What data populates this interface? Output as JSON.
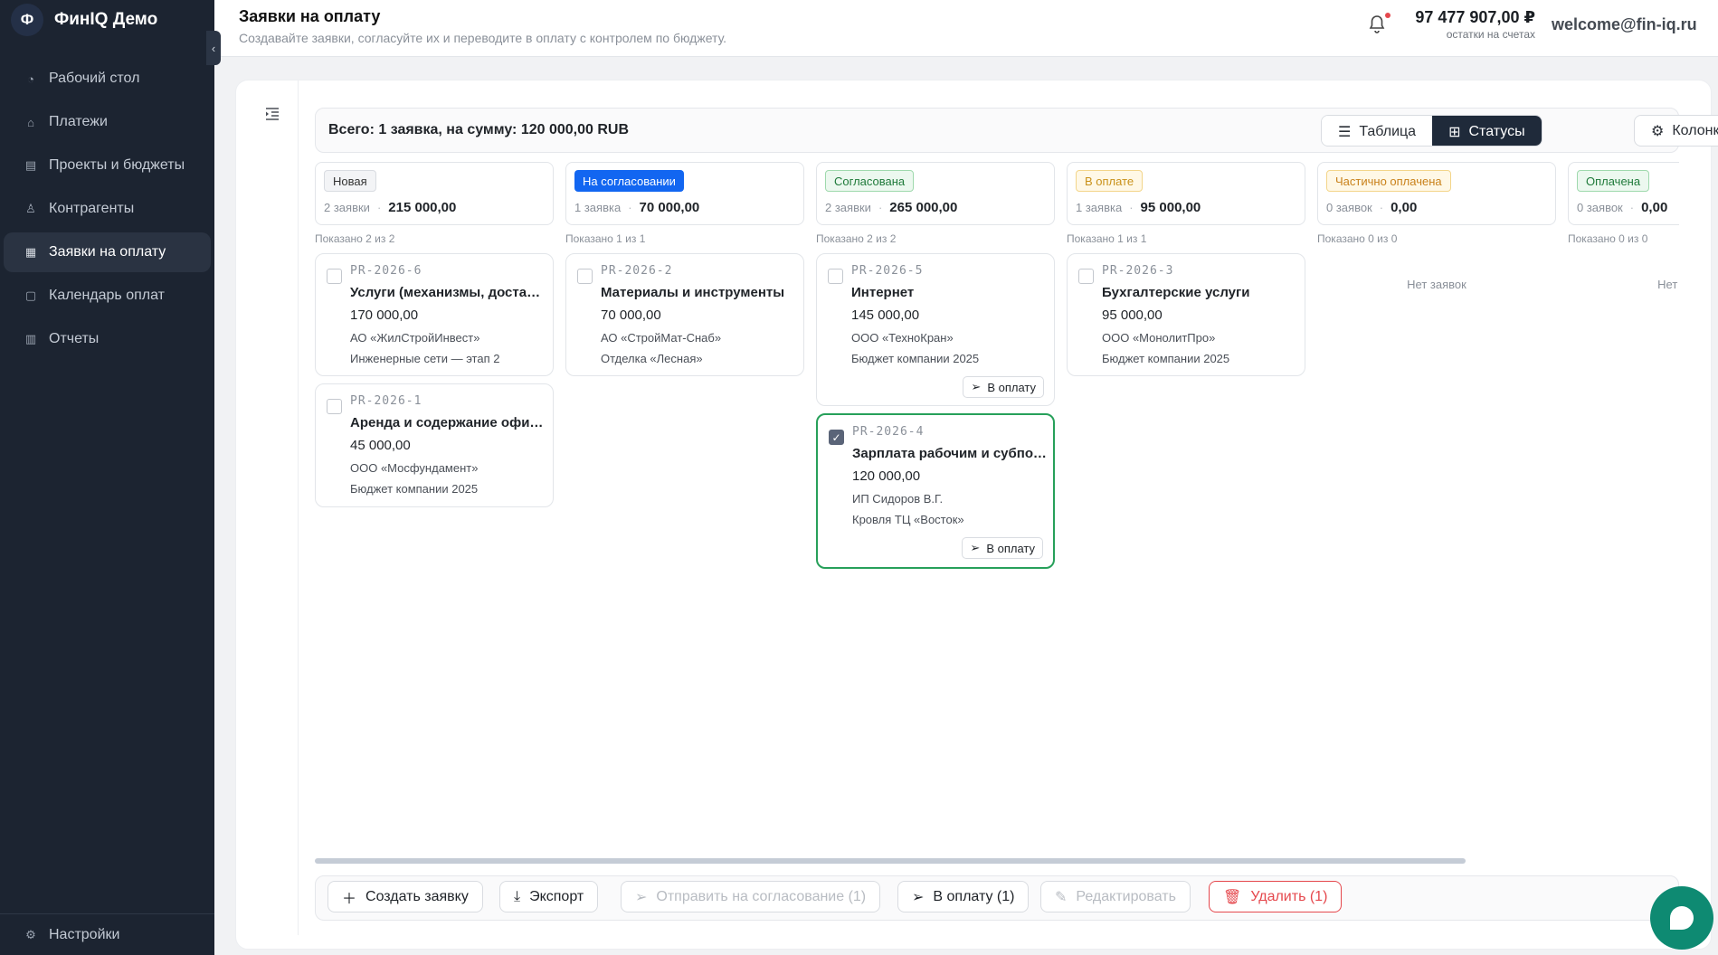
{
  "app": {
    "logo_letter": "Ф",
    "name": "ФинIQ Демо"
  },
  "sidebar": {
    "items": [
      {
        "label": "Рабочий стол",
        "icon": "dashboard-icon"
      },
      {
        "label": "Платежи",
        "icon": "bank-icon"
      },
      {
        "label": "Проекты и бюджеты",
        "icon": "projects-icon"
      },
      {
        "label": "Контрагенты",
        "icon": "users-icon"
      },
      {
        "label": "Заявки на оплату",
        "icon": "document-icon",
        "active": true
      },
      {
        "label": "Календарь оплат",
        "icon": "calendar-icon"
      },
      {
        "label": "Отчеты",
        "icon": "chart-icon"
      }
    ],
    "footer": {
      "label": "Настройки",
      "icon": "gear-icon"
    }
  },
  "header": {
    "title": "Заявки на оплату",
    "subtitle": "Создавайте заявки, согласуйте их и переводите в оплату с контролем по бюджету.",
    "balance_amount": "97 477 907,00 ₽",
    "balance_label": "остатки на счетах",
    "user_email": "welcome@fin-iq.ru"
  },
  "summary": {
    "text": "Всего: 1 заявка, на сумму: 120 000,00 RUB"
  },
  "view_toggle": {
    "table": "Таблица",
    "statuses": "Статусы",
    "columns": "Колонки"
  },
  "columns": [
    {
      "status": "Новая",
      "count": "2 заявки",
      "sum": "215 000,00",
      "shown": "Показано 2 из 2",
      "cards": [
        {
          "code": "PR-2026-6",
          "title": "Услуги (механизмы, доставка)",
          "amount": "170 000,00",
          "party": "АО «ЖилСтройИнвест»",
          "project": "Инженерные сети — этап 2"
        },
        {
          "code": "PR-2026-1",
          "title": "Аренда и содержание офиса",
          "amount": "45 000,00",
          "party": "ООО «Мосфундамент»",
          "project": "Бюджет компании 2025"
        }
      ]
    },
    {
      "status": "На согласовании",
      "count": "1 заявка",
      "sum": "70 000,00",
      "shown": "Показано 1 из 1",
      "cards": [
        {
          "code": "PR-2026-2",
          "title": "Материалы и инструменты",
          "amount": "70 000,00",
          "party": "АО «СтройМат-Снаб»",
          "project": "Отделка «Лесная»"
        }
      ]
    },
    {
      "status": "Согласована",
      "count": "2 заявки",
      "sum": "265 000,00",
      "shown": "Показано 2 из 2",
      "cards": [
        {
          "code": "PR-2026-5",
          "title": "Интернет",
          "amount": "145 000,00",
          "party": "ООО «ТехноКран»",
          "project": "Бюджет компании 2025",
          "action": "В оплату"
        },
        {
          "code": "PR-2026-4",
          "title": "Зарплата рабочим и субподрядчикам",
          "amount": "120 000,00",
          "party": "ИП Сидоров В.Г.",
          "project": "Кровля ТЦ «Восток»",
          "action": "В оплату",
          "selected": true
        }
      ]
    },
    {
      "status": "В оплате",
      "count": "1 заявка",
      "sum": "95 000,00",
      "shown": "Показано 1 из 1",
      "cards": [
        {
          "code": "PR-2026-3",
          "title": "Бухгалтерские услуги",
          "amount": "95 000,00",
          "party": "ООО «МонолитПро»",
          "project": "Бюджет компании 2025"
        }
      ]
    },
    {
      "status": "Частично оплачена",
      "count": "0 заявок",
      "sum": "0,00",
      "shown": "Показано 0 из 0",
      "empty": "Нет заявок"
    },
    {
      "status": "Оплачена",
      "count": "0 заявок",
      "sum": "0,00",
      "shown": "Показано 0 из 0",
      "empty": "Нет заявок"
    }
  ],
  "actions": {
    "create": "Создать заявку",
    "export": "Экспорт",
    "send_approval": "Отправить на согласование (1)",
    "to_payment": "В оплату (1)",
    "edit": "Редактировать",
    "delete": "Удалить (1)"
  },
  "colors": {
    "sidebar_bg": "#1c2431",
    "accent_blue": "#1266f1",
    "selected_border": "#27a05a",
    "danger": "#e5484d",
    "chat": "#0e8a72"
  }
}
